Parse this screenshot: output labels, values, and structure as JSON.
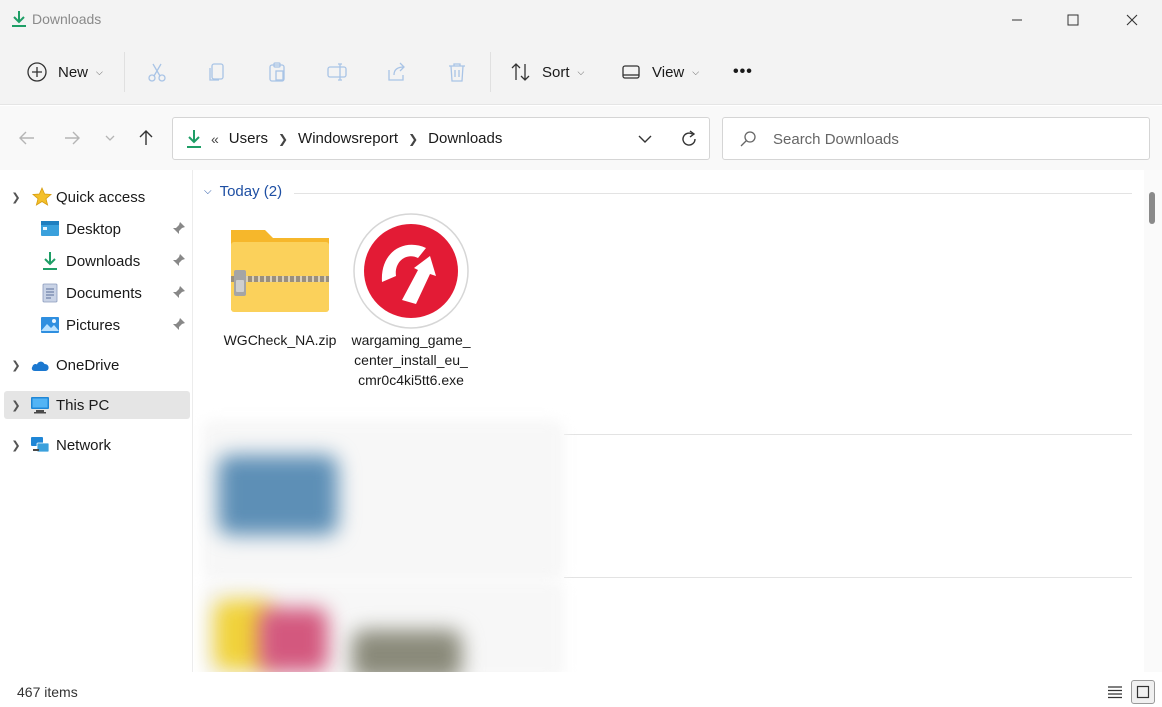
{
  "window": {
    "title": "Downloads"
  },
  "toolbar": {
    "new_label": "New",
    "sort_label": "Sort",
    "view_label": "View",
    "more_label": "•••"
  },
  "address": {
    "overflow": "«",
    "breadcrumbs": [
      "Users",
      "Windowsreport",
      "Downloads"
    ]
  },
  "search": {
    "placeholder": "Search Downloads"
  },
  "sidebar": {
    "items": [
      {
        "label": "Quick access",
        "icon": "star-icon"
      },
      {
        "label": "Desktop",
        "icon": "desktop-icon",
        "pinned": true
      },
      {
        "label": "Downloads",
        "icon": "download-icon",
        "pinned": true
      },
      {
        "label": "Documents",
        "icon": "document-icon",
        "pinned": true
      },
      {
        "label": "Pictures",
        "icon": "pictures-icon",
        "pinned": true
      },
      {
        "label": "OneDrive",
        "icon": "cloud-icon"
      },
      {
        "label": "This PC",
        "icon": "monitor-icon"
      },
      {
        "label": "Network",
        "icon": "network-icon"
      }
    ]
  },
  "content": {
    "group_header": "Today (2)",
    "files": [
      {
        "name": "WGCheck_NA.zip",
        "icon": "zip-folder-icon"
      },
      {
        "name": "wargaming_game_center_install_eu_cmr0c4ki5tt6.exe",
        "icon": "wargaming-app-icon"
      }
    ]
  },
  "status": {
    "item_count": "467 items"
  },
  "colors": {
    "accent": "#1e4fa3",
    "download_green": "#1e9e66",
    "folder_yellow": "#f6c342",
    "wargaming_red": "#e31b35"
  }
}
